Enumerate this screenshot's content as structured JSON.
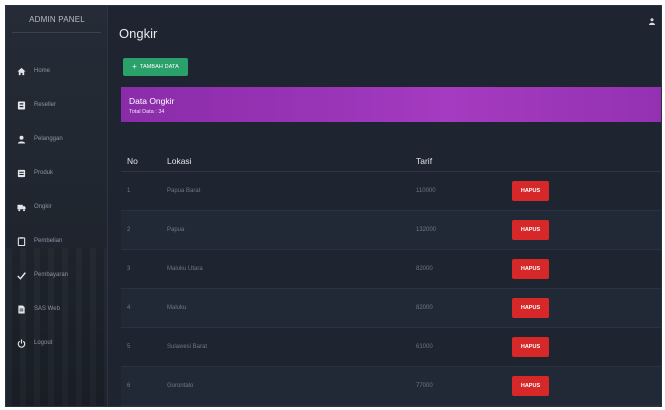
{
  "sidebar": {
    "brand": "ADMIN PANEL",
    "items": [
      {
        "label": "Home",
        "icon": "home-icon"
      },
      {
        "label": "Reseller",
        "icon": "id-card-icon"
      },
      {
        "label": "Pelanggan",
        "icon": "user-icon"
      },
      {
        "label": "Produk",
        "icon": "box-icon"
      },
      {
        "label": "Ongkir",
        "icon": "truck-icon"
      },
      {
        "label": "Pembelian",
        "icon": "clipboard-icon"
      },
      {
        "label": "Pembayaran",
        "icon": "check-icon"
      },
      {
        "label": "SAS Web",
        "icon": "document-icon"
      },
      {
        "label": "Logout",
        "icon": "power-icon"
      }
    ]
  },
  "main": {
    "title": "Ongkir",
    "add_button": "TAMBAH DATA",
    "banner": {
      "title": "Data Ongkir",
      "subtitle": "Total Data : 34"
    },
    "table": {
      "headers": {
        "no": "No",
        "lokasi": "Lokasi",
        "tarif": "Tarif"
      },
      "delete_label": "HAPUS",
      "rows": [
        {
          "no": "1",
          "lokasi": "Papua Barat",
          "tarif": "110000"
        },
        {
          "no": "2",
          "lokasi": "Papua",
          "tarif": "132000"
        },
        {
          "no": "3",
          "lokasi": "Maluku Utara",
          "tarif": "82000"
        },
        {
          "no": "4",
          "lokasi": "Maluku",
          "tarif": "82000"
        },
        {
          "no": "5",
          "lokasi": "Sulawesi Barat",
          "tarif": "61000"
        },
        {
          "no": "6",
          "lokasi": "Gorontalo",
          "tarif": "77000"
        }
      ]
    }
  },
  "colors": {
    "background": "#1e2430",
    "banner": "#9a35b8",
    "add_button": "#2aa06a",
    "delete_button": "#d62828"
  }
}
